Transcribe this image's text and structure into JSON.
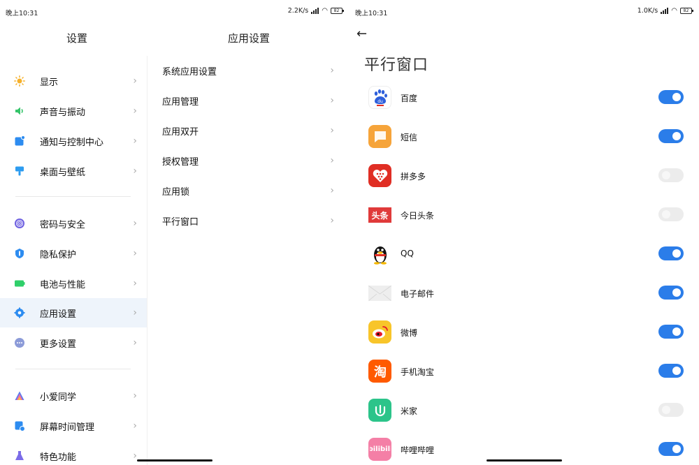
{
  "left": {
    "status": {
      "time": "晚上10:31",
      "speed": "2.2K/s",
      "battery": "82"
    },
    "title_settings": "设置",
    "title_app_settings": "应用设置",
    "menu": [
      {
        "label": "显示",
        "icon": "sun-icon",
        "color": "#f5b02a"
      },
      {
        "label": "声音与振动",
        "icon": "speaker-icon",
        "color": "#35c46a"
      },
      {
        "label": "通知与控制中心",
        "icon": "notification-icon",
        "color": "#2d8cf0"
      },
      {
        "label": "桌面与壁纸",
        "icon": "brush-icon",
        "color": "#2d9cf0"
      },
      {
        "label": "密码与安全",
        "icon": "fingerprint-icon",
        "color": "#6b5de0"
      },
      {
        "label": "隐私保护",
        "icon": "shield-icon",
        "color": "#2d8cf0"
      },
      {
        "label": "电池与性能",
        "icon": "battery-icon",
        "color": "#2fcf6a"
      },
      {
        "label": "应用设置",
        "icon": "gear-icon",
        "color": "#2d8cf0"
      },
      {
        "label": "更多设置",
        "icon": "more-icon",
        "color": "#8c9bd8"
      },
      {
        "label": "小爱同学",
        "icon": "xiaoai-icon",
        "color": "#5a7cf0"
      },
      {
        "label": "屏幕时间管理",
        "icon": "hourglass-icon",
        "color": "#2d8cf0"
      },
      {
        "label": "特色功能",
        "icon": "flask-icon",
        "color": "#7b6ce8"
      }
    ],
    "submenu": [
      {
        "label": "系统应用设置"
      },
      {
        "label": "应用管理"
      },
      {
        "label": "应用双开"
      },
      {
        "label": "授权管理"
      },
      {
        "label": "应用锁"
      },
      {
        "label": "平行窗口"
      }
    ]
  },
  "right": {
    "status": {
      "time": "晚上10:31",
      "speed": "1.0K/s",
      "battery": "82"
    },
    "title": "平行窗口",
    "apps": [
      {
        "name": "百度",
        "enabled": true,
        "icon": "baidu-icon",
        "color": "#2e5fdb"
      },
      {
        "name": "短信",
        "enabled": true,
        "icon": "message-icon",
        "color": "#f6a43a"
      },
      {
        "name": "拼多多",
        "enabled": false,
        "icon": "pinduoduo-icon",
        "color": "#e02e24"
      },
      {
        "name": "今日头条",
        "enabled": false,
        "icon": "toutiao-icon",
        "color": "#e03a3a"
      },
      {
        "name": "QQ",
        "enabled": true,
        "icon": "qq-penguin-icon",
        "color": "#111111"
      },
      {
        "name": "电子邮件",
        "enabled": true,
        "icon": "email-icon",
        "color": "#e8e8e8"
      },
      {
        "name": "微博",
        "enabled": true,
        "icon": "weibo-icon",
        "color": "#f8c52a"
      },
      {
        "name": "手机淘宝",
        "enabled": true,
        "icon": "taobao-icon",
        "color": "#ff5a00"
      },
      {
        "name": "米家",
        "enabled": false,
        "icon": "mijia-icon",
        "color": "#2cc48a"
      },
      {
        "name": "哔哩哔哩",
        "enabled": true,
        "icon": "bilibili-icon",
        "color": "#f47fa6"
      }
    ],
    "accent": "#2b7de9"
  }
}
